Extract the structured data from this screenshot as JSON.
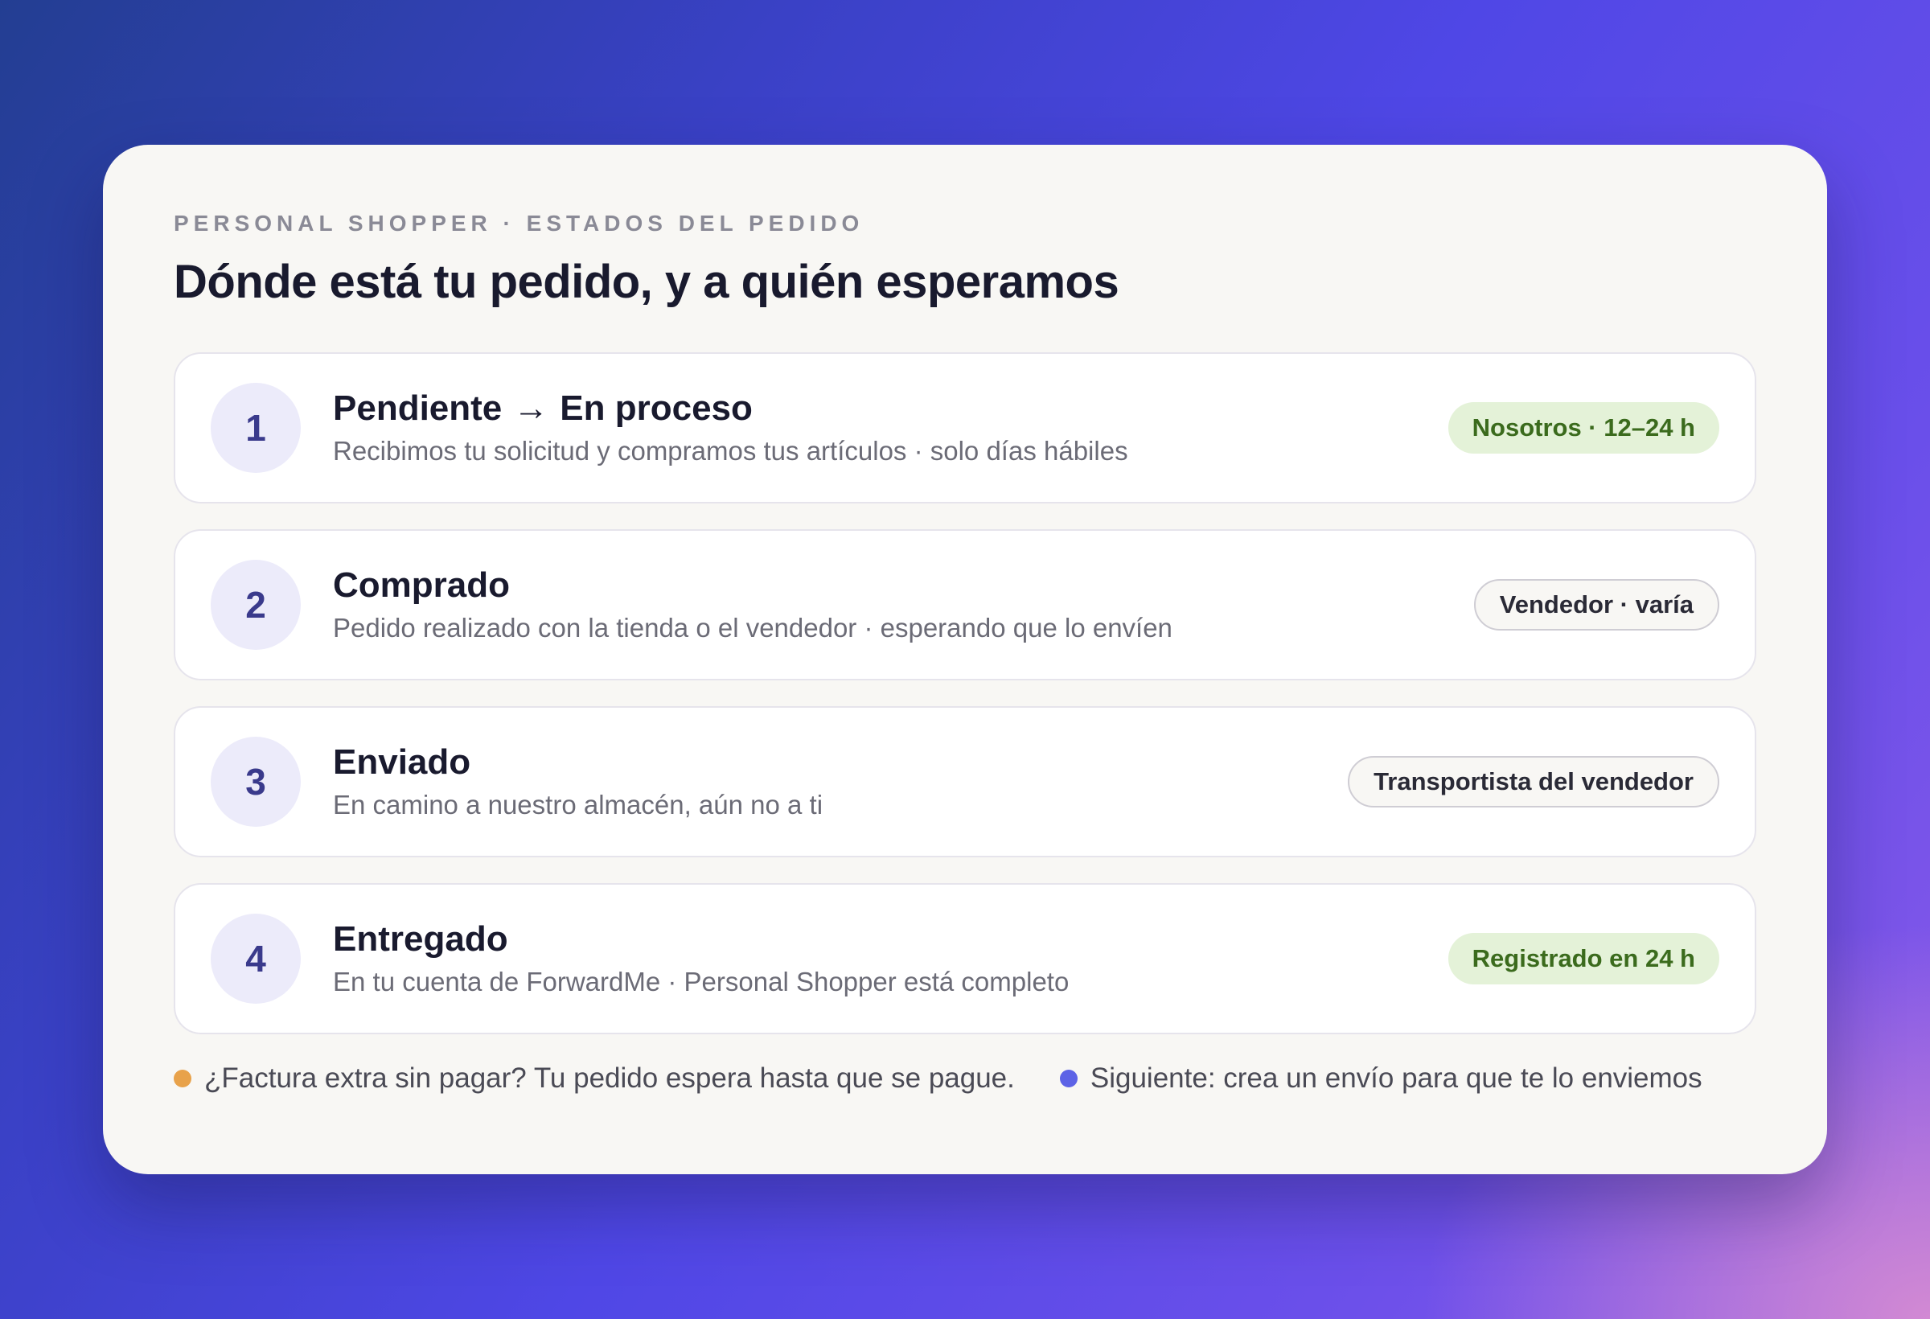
{
  "card": {
    "eyebrow": "PERSONAL SHOPPER · ESTADOS DEL PEDIDO",
    "title": "Dónde está tu pedido, y a quién esperamos"
  },
  "steps": [
    {
      "number": "1",
      "title_from": "Pendiente",
      "arrow": "→",
      "title_to": "En proceso",
      "description": "Recibimos tu solicitud y compramos tus artículos · solo días hábiles",
      "badge": "Nosotros · 12–24 h",
      "badge_style": "green"
    },
    {
      "number": "2",
      "title": "Comprado",
      "description": "Pedido realizado con la tienda o el vendedor · esperando que lo envíen",
      "badge": "Vendedor · varía",
      "badge_style": "outline"
    },
    {
      "number": "3",
      "title": "Enviado",
      "description": "En camino a nuestro almacén, aún no a ti",
      "badge": "Transportista del vendedor",
      "badge_style": "outline"
    },
    {
      "number": "4",
      "title": "Entregado",
      "description": "En tu cuenta de ForwardMe · Personal Shopper está completo",
      "badge": "Registrado en 24 h",
      "badge_style": "green"
    }
  ],
  "notes": [
    {
      "text": "¿Factura extra sin pagar? Tu pedido espera hasta que se pague.",
      "dot_color": "#e8a24a"
    },
    {
      "text": "Siguiente: crea un envío para que te lo enviemos",
      "dot_color": "#5d63e6"
    }
  ],
  "colors": {
    "badge_green_bg": "#e4f2d8",
    "badge_green_text": "#3b6b1d",
    "number_circle_bg": "#ecebfa",
    "number_text": "#3a3a8c"
  }
}
